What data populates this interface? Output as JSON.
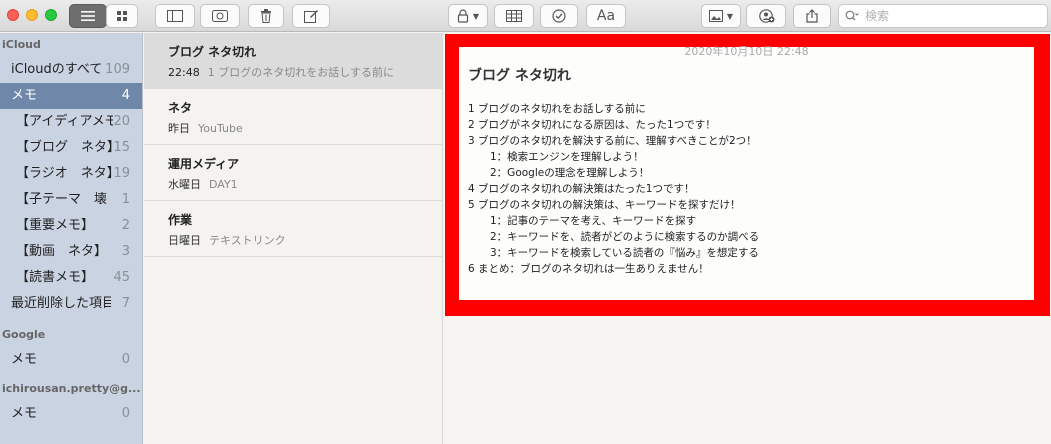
{
  "toolbar": {
    "search_placeholder": "検索",
    "font_button_label": "Aa"
  },
  "sidebar": {
    "sections": [
      {
        "header": "iCloud",
        "items": [
          {
            "label": "iCloudのすべて",
            "count": "109"
          },
          {
            "label": "メモ",
            "count": "4",
            "selected": true
          },
          {
            "label": "【アイディアメモ",
            "count": "20",
            "sub": true
          },
          {
            "label": "【ブログ　ネタ】",
            "count": "15",
            "sub": true
          },
          {
            "label": "【ラジオ　ネタ】",
            "count": "19",
            "sub": true
          },
          {
            "label": "【子テーマ　壊",
            "count": "1",
            "sub": true
          },
          {
            "label": "【重要メモ】",
            "count": "2",
            "sub": true
          },
          {
            "label": "【動画　ネタ】",
            "count": "3",
            "sub": true
          },
          {
            "label": "【読書メモ】",
            "count": "45",
            "sub": true
          },
          {
            "label": "最近削除した項目",
            "count": "7"
          }
        ]
      },
      {
        "header": "Google",
        "items": [
          {
            "label": "メモ",
            "count": "0"
          }
        ]
      },
      {
        "header": "ichirousan.pretty@g...",
        "items": [
          {
            "label": "メモ",
            "count": "0"
          }
        ]
      }
    ]
  },
  "notes": [
    {
      "title": "ブログ ネタ切れ",
      "date": "22:48",
      "preview": "1 ブログのネタ切れをお話しする前に",
      "selected": true
    },
    {
      "title": "ネタ",
      "date": "昨日",
      "preview": "YouTube"
    },
    {
      "title": "運用メディア",
      "date": "水曜日",
      "preview": "DAY1"
    },
    {
      "title": "作業",
      "date": "日曜日",
      "preview": "テキストリンク"
    }
  ],
  "editor": {
    "timestamp": "2020年10月10日 22:48",
    "title": "ブログ ネタ切れ",
    "lines": [
      {
        "text": "1 ブログのネタ切れをお話しする前に"
      },
      {
        "text": "2 ブログがネタ切れになる原因は、たった1つです！"
      },
      {
        "text": "3 ブログのネタ切れを解決する前に、理解すべきことが2つ！"
      },
      {
        "text": "1：検索エンジンを理解しよう！",
        "indent": true
      },
      {
        "text": "2：Googleの理念を理解しよう！",
        "indent": true
      },
      {
        "text": "4 ブログのネタ切れの解決策はたった1つです！"
      },
      {
        "text": "5 ブログのネタ切れの解決策は、キーワードを探すだけ！"
      },
      {
        "text": "1：記事のテーマを考え、キーワードを探す",
        "indent": true
      },
      {
        "text": "2：キーワードを、読者がどのように検索するのか調べる",
        "indent": true
      },
      {
        "text": "3：キーワードを検索している読者の『悩み』を想定する",
        "indent": true
      },
      {
        "text": "6 まとめ：ブログのネタ切れは一生ありえません！"
      }
    ]
  },
  "colors": {
    "highlight_frame": "#ff0000",
    "sidebar_selected": "#6f87a9",
    "sidebar_bg": "#c9d3e2"
  }
}
